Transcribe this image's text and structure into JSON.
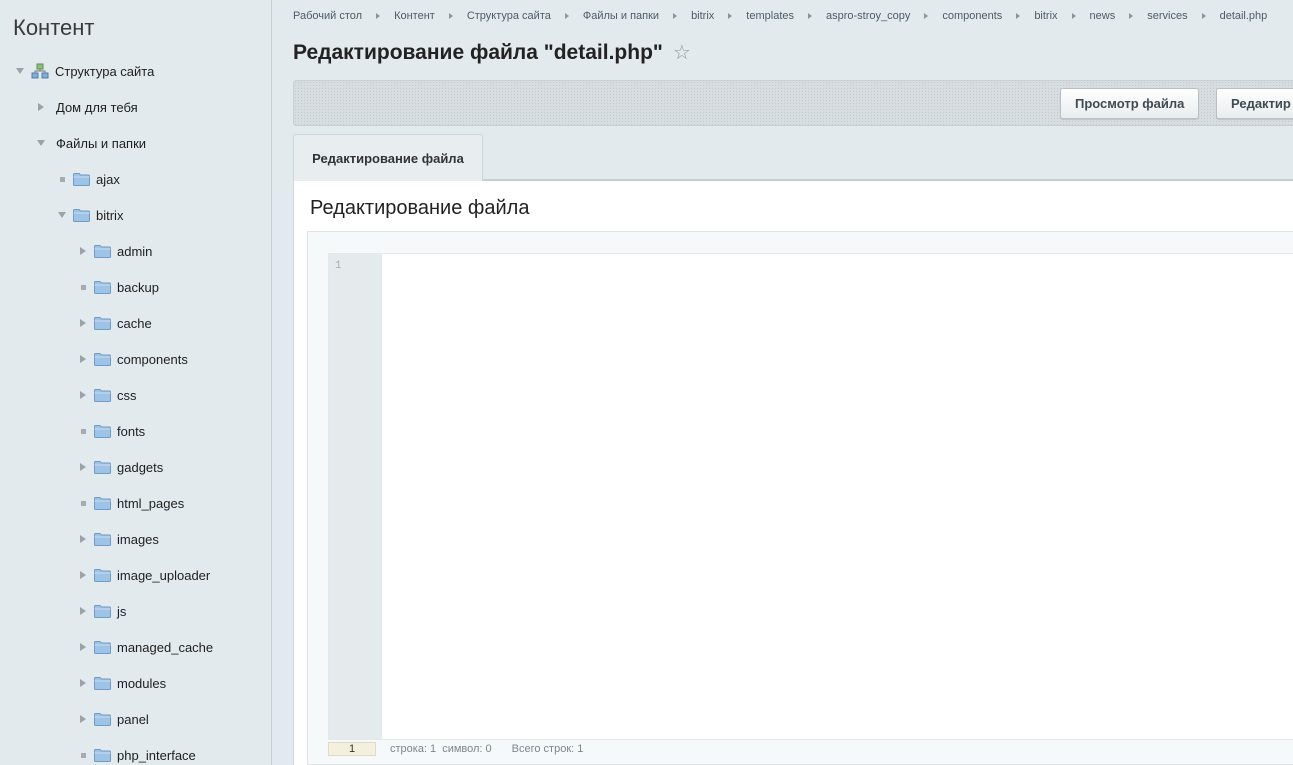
{
  "sidebar": {
    "title": "Контент",
    "items": [
      {
        "label": "Структура сайта",
        "toggle": "expanded",
        "icon": "site-structure-icon"
      },
      {
        "label": "Дом для тебя",
        "toggle": "collapsed",
        "icon": ""
      },
      {
        "label": "Файлы и папки",
        "toggle": "expanded",
        "icon": ""
      },
      {
        "label": "ajax",
        "toggle": "leaf",
        "icon": "folder-icon"
      },
      {
        "label": "bitrix",
        "toggle": "expanded",
        "icon": "folder-icon"
      },
      {
        "label": "admin",
        "toggle": "collapsed",
        "icon": "folder-icon"
      },
      {
        "label": "backup",
        "toggle": "leaf",
        "icon": "folder-icon"
      },
      {
        "label": "cache",
        "toggle": "collapsed",
        "icon": "folder-icon"
      },
      {
        "label": "components",
        "toggle": "collapsed",
        "icon": "folder-icon"
      },
      {
        "label": "css",
        "toggle": "collapsed",
        "icon": "folder-icon"
      },
      {
        "label": "fonts",
        "toggle": "leaf",
        "icon": "folder-icon"
      },
      {
        "label": "gadgets",
        "toggle": "collapsed",
        "icon": "folder-icon"
      },
      {
        "label": "html_pages",
        "toggle": "leaf",
        "icon": "folder-icon"
      },
      {
        "label": "images",
        "toggle": "collapsed",
        "icon": "folder-icon"
      },
      {
        "label": "image_uploader",
        "toggle": "collapsed",
        "icon": "folder-icon"
      },
      {
        "label": "js",
        "toggle": "collapsed",
        "icon": "folder-icon"
      },
      {
        "label": "managed_cache",
        "toggle": "collapsed",
        "icon": "folder-icon"
      },
      {
        "label": "modules",
        "toggle": "collapsed",
        "icon": "folder-icon"
      },
      {
        "label": "panel",
        "toggle": "collapsed",
        "icon": "folder-icon"
      },
      {
        "label": "php_interface",
        "toggle": "leaf",
        "icon": "folder-icon"
      }
    ]
  },
  "breadcrumb": [
    "Рабочий стол",
    "Контент",
    "Структура сайта",
    "Файлы и папки",
    "bitrix",
    "templates",
    "aspro-stroy_copy",
    "components",
    "bitrix",
    "news",
    "services",
    "detail.php"
  ],
  "page": {
    "title": "Редактирование файла \"detail.php\"",
    "star_icon": "star-icon"
  },
  "toolbar": {
    "view_file_label": "Просмотр файла",
    "edit_label": "Редактир"
  },
  "tabs": {
    "active_label": "Редактирование файла"
  },
  "panel": {
    "title": "Редактирование файла"
  },
  "editor": {
    "line_number": "1",
    "status": {
      "current_line": "1",
      "line_text": "строка: 1",
      "symbol_text": "символ: 0",
      "total_text": "Всего строк: 1"
    }
  },
  "colors": {
    "background": "#e3eaed",
    "panel": "#ffffff",
    "folder": "#9dc3e6",
    "toggle": "#9aa3a8"
  }
}
